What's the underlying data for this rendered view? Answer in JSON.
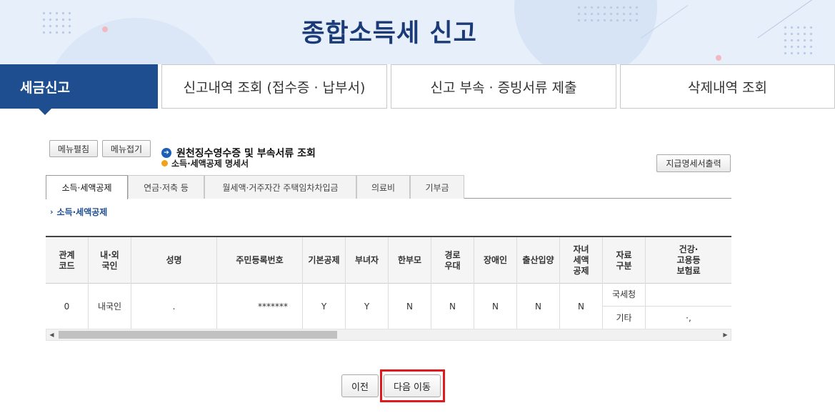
{
  "banner": {
    "title": "종합소득세 신고"
  },
  "main_tabs": [
    {
      "label": "세금신고"
    },
    {
      "label": "신고내역 조회 (접수증 · 납부서)"
    },
    {
      "label": "신고 부속 · 증빙서류 제출"
    },
    {
      "label": "삭제내역 조회"
    }
  ],
  "menu_buttons": {
    "expand": "메뉴펼침",
    "collapse": "메뉴접기"
  },
  "heading": {
    "title": "원천징수영수증 및 부속서류 조회",
    "subtitle": "소득·세액공제 명세서"
  },
  "print_button": "지급명세서출력",
  "sub_tabs": [
    {
      "label": "소득·세액공제"
    },
    {
      "label": "연금·저축 등"
    },
    {
      "label": "월세액·거주자간 주택임차차입금"
    },
    {
      "label": "의료비"
    },
    {
      "label": "기부금"
    }
  ],
  "section_label": "소득·세액공제",
  "table": {
    "headers": [
      "관계\n코드",
      "내·외\n국인",
      "성명",
      "주민등록번호",
      "기본공제",
      "부녀자",
      "한부모",
      "경로\n우대",
      "장애인",
      "출산입양",
      "자녀\n세액\n공제",
      "자료\n구분",
      "건강·\n고용등\n보험료"
    ],
    "row": {
      "relation_code": "0",
      "nationality": "내국인",
      "name": ".",
      "resident_no": "*******",
      "basic": "Y",
      "woman": "Y",
      "single_parent": "N",
      "senior": "N",
      "disabled": "N",
      "birth_adopt": "N",
      "child_credit": "N",
      "source_1": "국세청",
      "source_2": "기타",
      "insurance_2": "·,"
    }
  },
  "scrollbar": {
    "left": "◀",
    "right": "▶"
  },
  "bottom_buttons": {
    "prev": "이전",
    "next": "다음 이동"
  },
  "colors": {
    "primary": "#1e4e8f",
    "highlight": "#e0191f"
  }
}
